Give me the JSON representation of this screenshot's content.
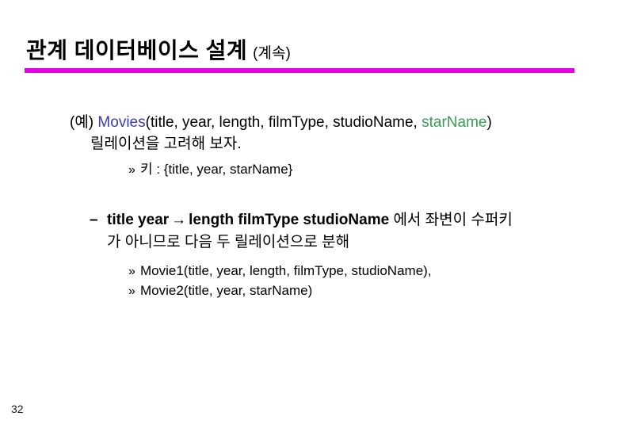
{
  "slide": {
    "title": {
      "main": "관계 데이터베이스 설계",
      "suffix": "(계속)",
      "rule_color": "#e600e6"
    },
    "page_number": "32",
    "colors": {
      "accent_rule": "#e600e6",
      "relation_name": "#3b3bb0",
      "attribute_highlight": "#3a9a57",
      "text": "#000000",
      "background": "#ffffff"
    },
    "bullets": {
      "example": {
        "prefix": "(예)",
        "relation_name": "Movies",
        "open_paren": "(",
        "attributes_plain": "title, year, length, filmType, studioName, ",
        "attribute_highlighted": "starName",
        "close_paren": ")",
        "continuation": "릴레이션을 고려해 보자."
      },
      "key_note": {
        "marker": "»",
        "text": "키 : {title, year, starName}"
      },
      "decompose": {
        "marker": "–",
        "fd_left": "title year",
        "arrow": "→",
        "fd_right": "length  filmType  studioName",
        "korean_tail": "에서 좌변이 수퍼키",
        "continuation": "가 아니므로 다음 두 릴레이션으로 분해"
      },
      "results": [
        {
          "marker": "»",
          "text": "Movie1(title, year, length, filmType, studioName),"
        },
        {
          "marker": "»",
          "text": "Movie2(title, year, starName)"
        }
      ]
    }
  }
}
